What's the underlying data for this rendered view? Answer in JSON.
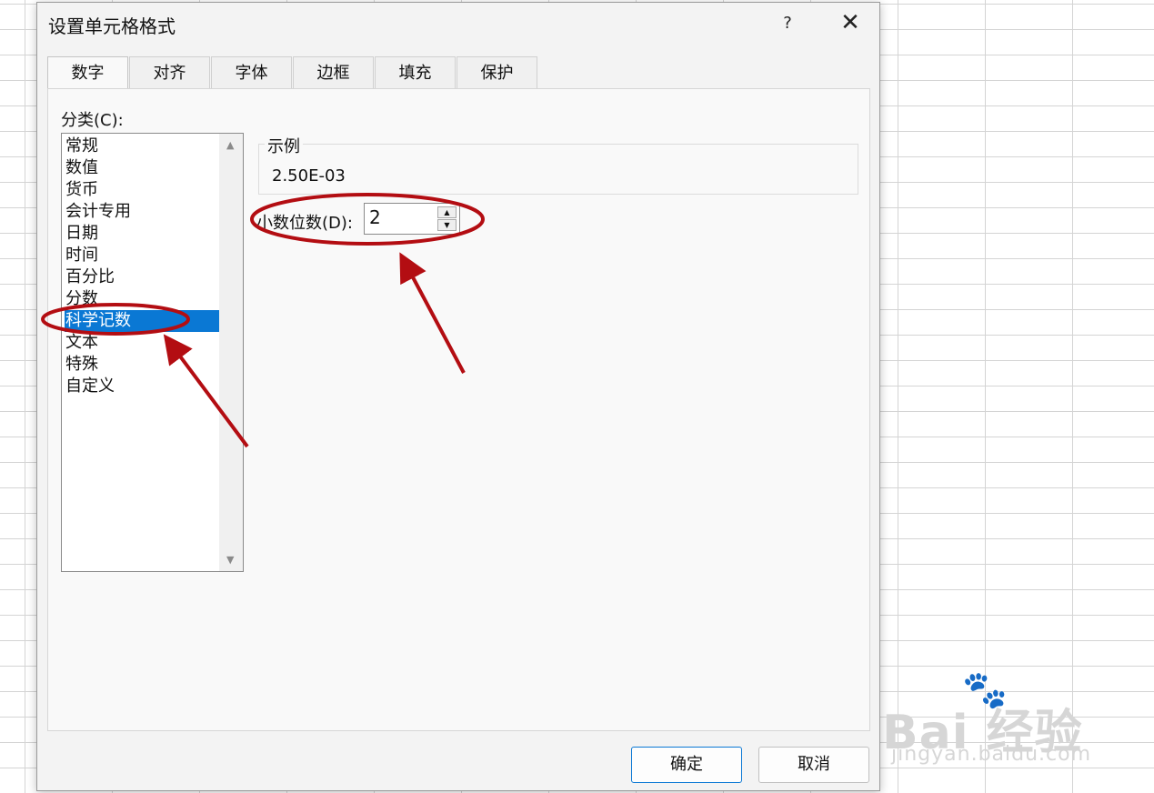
{
  "dialog": {
    "title": "设置单元格格式",
    "help_label": "?",
    "close_label": "✕"
  },
  "tabs": [
    {
      "label": "数字",
      "active": true
    },
    {
      "label": "对齐"
    },
    {
      "label": "字体"
    },
    {
      "label": "边框"
    },
    {
      "label": "填充"
    },
    {
      "label": "保护"
    }
  ],
  "category": {
    "label": "分类(C):",
    "items": [
      "常规",
      "数值",
      "货币",
      "会计专用",
      "日期",
      "时间",
      "百分比",
      "分数",
      "科学记数",
      "文本",
      "特殊",
      "自定义"
    ],
    "selected": "科学记数"
  },
  "sample": {
    "legend": "示例",
    "value": "2.50E-03"
  },
  "decimal": {
    "label": "小数位数(D):",
    "value": "2"
  },
  "buttons": {
    "ok": "确定",
    "cancel": "取消"
  },
  "watermark": {
    "brand": "Bai 经验",
    "url": "jingyan.baidu.com"
  },
  "colors": {
    "selection": "#0a78d4",
    "annotation": "#b30d12"
  }
}
